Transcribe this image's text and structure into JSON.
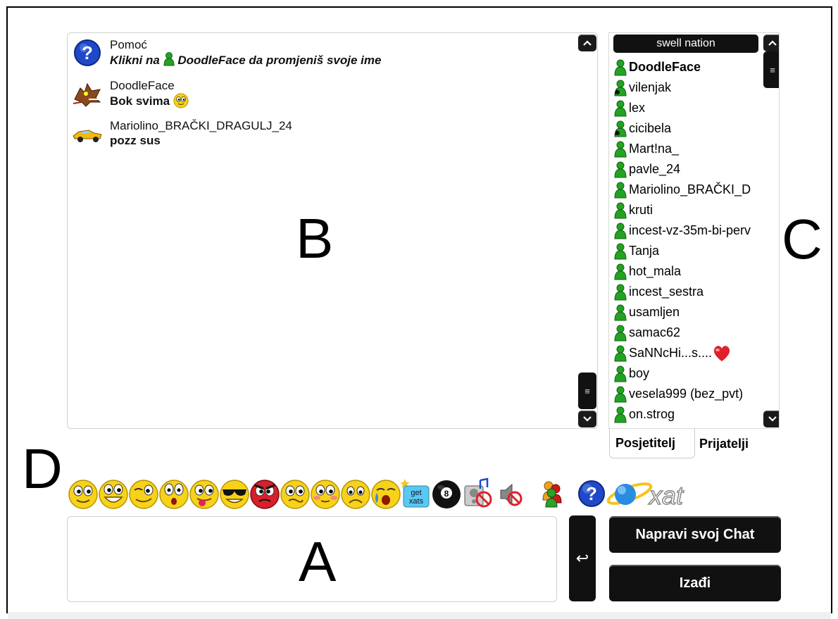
{
  "labels": {
    "b": "B",
    "c": "C",
    "d": "D",
    "a": "A"
  },
  "messages": [
    {
      "name": "Pomoć",
      "text_prefix": "Klikni na",
      "text_name": "DoodleFace",
      "text_suffix": "da promjeniš svoje ime",
      "avatar": "help-question-icon"
    },
    {
      "name": "DoodleFace",
      "text": "Bok svima",
      "avatar": "dragon-avatar-icon",
      "emoticon": "smiley-icon"
    },
    {
      "name": "Mariolino_BRAČKI_DRAGULJ_24",
      "text": "pozz sus",
      "avatar": "yellow-car-avatar-icon"
    }
  ],
  "users": {
    "group_name": "swell nation",
    "items": [
      {
        "name": "DoodleFace",
        "self": true,
        "icon": "green"
      },
      {
        "name": "vilenjak",
        "icon": "mod"
      },
      {
        "name": "lex",
        "icon": "green"
      },
      {
        "name": "cicibela",
        "icon": "mod"
      },
      {
        "name": "Mart!na_",
        "icon": "green"
      },
      {
        "name": "pavle_24",
        "icon": "green"
      },
      {
        "name": "Mariolino_BRAČKI_D",
        "icon": "green"
      },
      {
        "name": "kruti",
        "icon": "green"
      },
      {
        "name": "incest-vz-35m-bi-perv",
        "icon": "green"
      },
      {
        "name": "Tanja",
        "icon": "green"
      },
      {
        "name": "hot_mala",
        "icon": "green"
      },
      {
        "name": "incest_sestra",
        "icon": "green"
      },
      {
        "name": "usamljen",
        "icon": "green"
      },
      {
        "name": "samac62",
        "icon": "green"
      },
      {
        "name": "SaNNcHi...s....",
        "icon": "green",
        "heart": true
      },
      {
        "name": "boy",
        "icon": "green"
      },
      {
        "name": "vesela999 (bez_pvt)",
        "icon": "green"
      },
      {
        "name": "on.strog",
        "icon": "green"
      }
    ]
  },
  "tabs": {
    "visitors": "Posjetitelj",
    "friends": "Prijatelji"
  },
  "buttons": {
    "create_chat": "Napravi svoj Chat",
    "exit": "Izađi",
    "send": "↩"
  },
  "toolbar": {
    "getxats_top": "get",
    "getxats_bottom": "xats",
    "xat_logo": "xat"
  },
  "colors": {
    "button_bg": "#111111",
    "user_green": "#1e9b1e",
    "help_blue": "#1f49c8",
    "smiley_yellow": "#f7d21a"
  }
}
